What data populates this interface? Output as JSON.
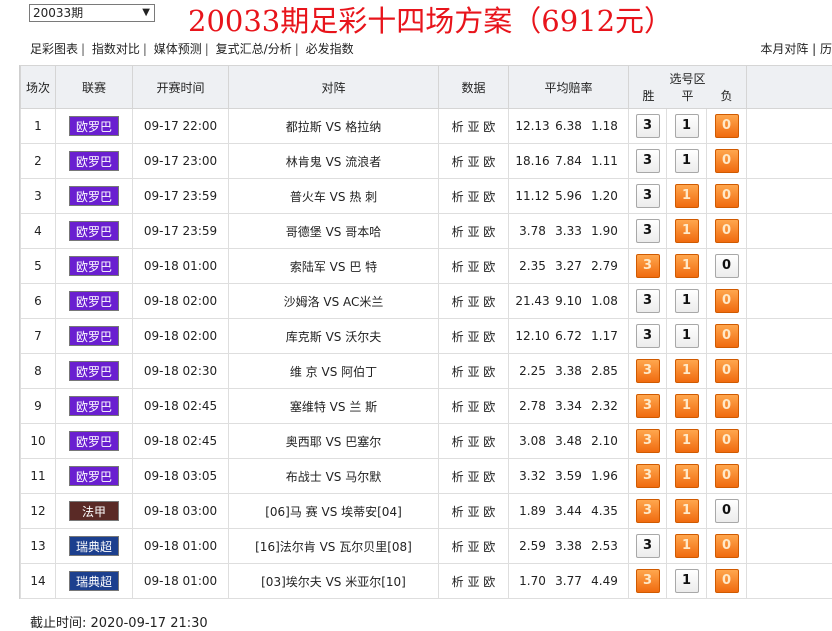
{
  "period_select": {
    "value": "20033期",
    "arrow": "▼"
  },
  "title": "20033期足彩十四场方案（6912元）",
  "nav": {
    "left": [
      "足彩图表",
      "指数对比",
      "媒体预测",
      "复式汇总/分析",
      "必发指数"
    ],
    "right": "本月对阵 | 历"
  },
  "headers": {
    "round": "场次",
    "league": "联赛",
    "time": "开赛时间",
    "match": "对阵",
    "data": "数据",
    "odds": "平均赔率",
    "pick_zone": "选号区",
    "win": "胜",
    "draw": "平",
    "lose": "负"
  },
  "colors": {
    "euro_league": "#6a1fd0",
    "ligue1": "#5a2a26",
    "allsvenskan": "#1c3f8e",
    "selected": "#f07a1a",
    "title_red": "#e8141b"
  },
  "rows": [
    {
      "no": "1",
      "league": "欧罗巴",
      "league_color": "#6a1fd0",
      "time": "09-17 22:00",
      "match": "都拉斯 VS 格拉纳",
      "data": "析 亚 欧",
      "odds": [
        "12.13",
        "6.38",
        "1.18"
      ],
      "picks": [
        {
          "v": "3",
          "on": false
        },
        {
          "v": "1",
          "on": false
        },
        {
          "v": "0",
          "on": true
        }
      ]
    },
    {
      "no": "2",
      "league": "欧罗巴",
      "league_color": "#6a1fd0",
      "time": "09-17 23:00",
      "match": "林肯鬼 VS 流浪者",
      "data": "析 亚 欧",
      "odds": [
        "18.16",
        "7.84",
        "1.11"
      ],
      "picks": [
        {
          "v": "3",
          "on": false
        },
        {
          "v": "1",
          "on": false
        },
        {
          "v": "0",
          "on": true
        }
      ]
    },
    {
      "no": "3",
      "league": "欧罗巴",
      "league_color": "#6a1fd0",
      "time": "09-17 23:59",
      "match": "普火车 VS 热 刺",
      "data": "析 亚 欧",
      "odds": [
        "11.12",
        "5.96",
        "1.20"
      ],
      "picks": [
        {
          "v": "3",
          "on": false
        },
        {
          "v": "1",
          "on": true
        },
        {
          "v": "0",
          "on": true
        }
      ]
    },
    {
      "no": "4",
      "league": "欧罗巴",
      "league_color": "#6a1fd0",
      "time": "09-17 23:59",
      "match": "哥德堡 VS 哥本哈",
      "data": "析 亚 欧",
      "odds": [
        "3.78",
        "3.33",
        "1.90"
      ],
      "picks": [
        {
          "v": "3",
          "on": false
        },
        {
          "v": "1",
          "on": true
        },
        {
          "v": "0",
          "on": true
        }
      ]
    },
    {
      "no": "5",
      "league": "欧罗巴",
      "league_color": "#6a1fd0",
      "time": "09-18 01:00",
      "match": "索陆军 VS 巴 特",
      "data": "析 亚 欧",
      "odds": [
        "2.35",
        "3.27",
        "2.79"
      ],
      "picks": [
        {
          "v": "3",
          "on": true
        },
        {
          "v": "1",
          "on": true
        },
        {
          "v": "0",
          "on": false
        }
      ]
    },
    {
      "no": "6",
      "league": "欧罗巴",
      "league_color": "#6a1fd0",
      "time": "09-18 02:00",
      "match": "沙姆洛 VS AC米兰",
      "data": "析 亚 欧",
      "odds": [
        "21.43",
        "9.10",
        "1.08"
      ],
      "picks": [
        {
          "v": "3",
          "on": false
        },
        {
          "v": "1",
          "on": false
        },
        {
          "v": "0",
          "on": true
        }
      ]
    },
    {
      "no": "7",
      "league": "欧罗巴",
      "league_color": "#6a1fd0",
      "time": "09-18 02:00",
      "match": "库克斯 VS 沃尔夫",
      "data": "析 亚 欧",
      "odds": [
        "12.10",
        "6.72",
        "1.17"
      ],
      "picks": [
        {
          "v": "3",
          "on": false
        },
        {
          "v": "1",
          "on": false
        },
        {
          "v": "0",
          "on": true
        }
      ]
    },
    {
      "no": "8",
      "league": "欧罗巴",
      "league_color": "#6a1fd0",
      "time": "09-18 02:30",
      "match": "维 京 VS 阿伯丁",
      "data": "析 亚 欧",
      "odds": [
        "2.25",
        "3.38",
        "2.85"
      ],
      "picks": [
        {
          "v": "3",
          "on": true
        },
        {
          "v": "1",
          "on": true
        },
        {
          "v": "0",
          "on": true
        }
      ]
    },
    {
      "no": "9",
      "league": "欧罗巴",
      "league_color": "#6a1fd0",
      "time": "09-18 02:45",
      "match": "塞维特 VS 兰 斯",
      "data": "析 亚 欧",
      "odds": [
        "2.78",
        "3.34",
        "2.32"
      ],
      "picks": [
        {
          "v": "3",
          "on": true
        },
        {
          "v": "1",
          "on": true
        },
        {
          "v": "0",
          "on": true
        }
      ]
    },
    {
      "no": "10",
      "league": "欧罗巴",
      "league_color": "#6a1fd0",
      "time": "09-18 02:45",
      "match": "奥西耶 VS 巴塞尔",
      "data": "析 亚 欧",
      "odds": [
        "3.08",
        "3.48",
        "2.10"
      ],
      "picks": [
        {
          "v": "3",
          "on": true
        },
        {
          "v": "1",
          "on": true
        },
        {
          "v": "0",
          "on": true
        }
      ]
    },
    {
      "no": "11",
      "league": "欧罗巴",
      "league_color": "#6a1fd0",
      "time": "09-18 03:05",
      "match": "布战士 VS 马尔默",
      "data": "析 亚 欧",
      "odds": [
        "3.32",
        "3.59",
        "1.96"
      ],
      "picks": [
        {
          "v": "3",
          "on": true
        },
        {
          "v": "1",
          "on": true
        },
        {
          "v": "0",
          "on": true
        }
      ]
    },
    {
      "no": "12",
      "league": "法甲",
      "league_color": "#5a2a26",
      "time": "09-18 03:00",
      "match": "[06]马 赛 VS 埃蒂安[04]",
      "data": "析 亚 欧",
      "odds": [
        "1.89",
        "3.44",
        "4.35"
      ],
      "picks": [
        {
          "v": "3",
          "on": true
        },
        {
          "v": "1",
          "on": true
        },
        {
          "v": "0",
          "on": false
        }
      ]
    },
    {
      "no": "13",
      "league": "瑞典超",
      "league_color": "#1c3f8e",
      "time": "09-18 01:00",
      "match": "[16]法尔肯 VS 瓦尔贝里[08]",
      "data": "析 亚 欧",
      "odds": [
        "2.59",
        "3.38",
        "2.53"
      ],
      "picks": [
        {
          "v": "3",
          "on": false
        },
        {
          "v": "1",
          "on": true
        },
        {
          "v": "0",
          "on": true
        }
      ]
    },
    {
      "no": "14",
      "league": "瑞典超",
      "league_color": "#1c3f8e",
      "time": "09-18 01:00",
      "match": "[03]埃尔夫 VS 米亚尔[10]",
      "data": "析 亚 欧",
      "odds": [
        "1.70",
        "3.77",
        "4.49"
      ],
      "picks": [
        {
          "v": "3",
          "on": true
        },
        {
          "v": "1",
          "on": false
        },
        {
          "v": "0",
          "on": true
        }
      ]
    }
  ],
  "deadline_label": "截止时间:",
  "deadline_value": "2020-09-17 21:30"
}
